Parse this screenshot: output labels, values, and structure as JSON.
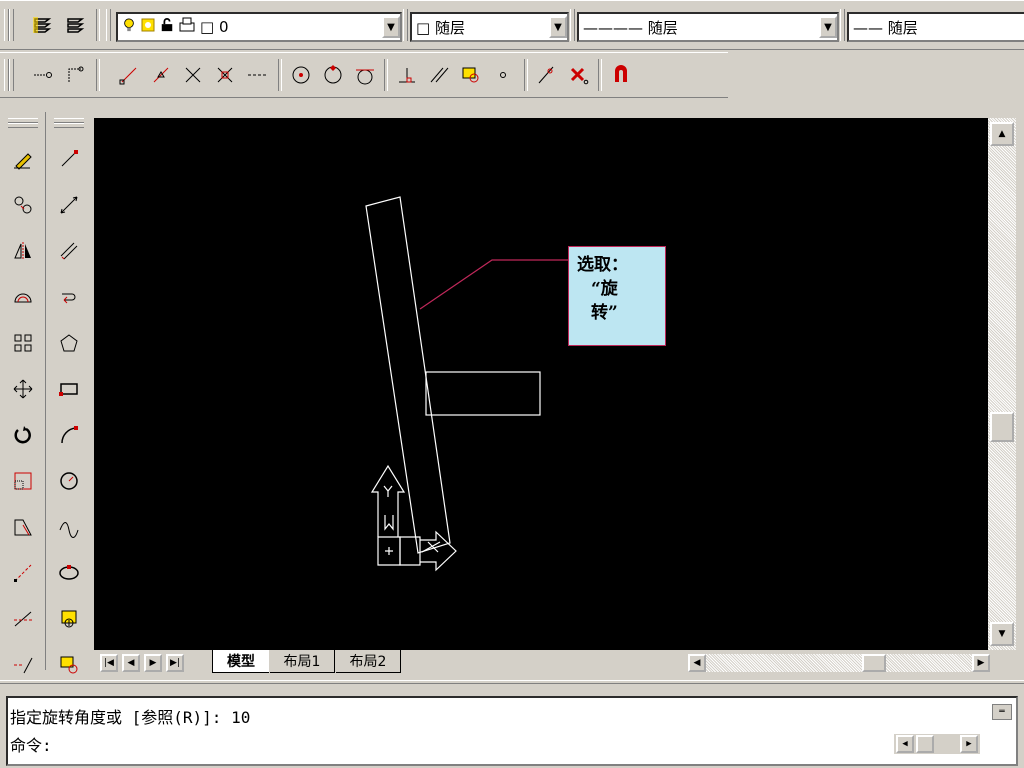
{
  "layer_toolbar": {
    "layer_combo_value": "□ 0",
    "color_combo_value": "□ 随层",
    "linetype_combo_value": "———— 随层",
    "lineweight_combo_value": "—— 随层"
  },
  "layout_tabs": [
    "模型",
    "布局1",
    "布局2"
  ],
  "callout": {
    "line1": "选取：",
    "line2": "“旋",
    "line3": "转”"
  },
  "command_window": {
    "line1": "指定旋转角度或 [参照(R)]: 10",
    "line2": "命令:"
  },
  "colors": {
    "canvas_bg": "#000000",
    "callout_bg": "#bde6f2",
    "callout_border": "#c0285a",
    "leader_line": "#c0285a"
  }
}
